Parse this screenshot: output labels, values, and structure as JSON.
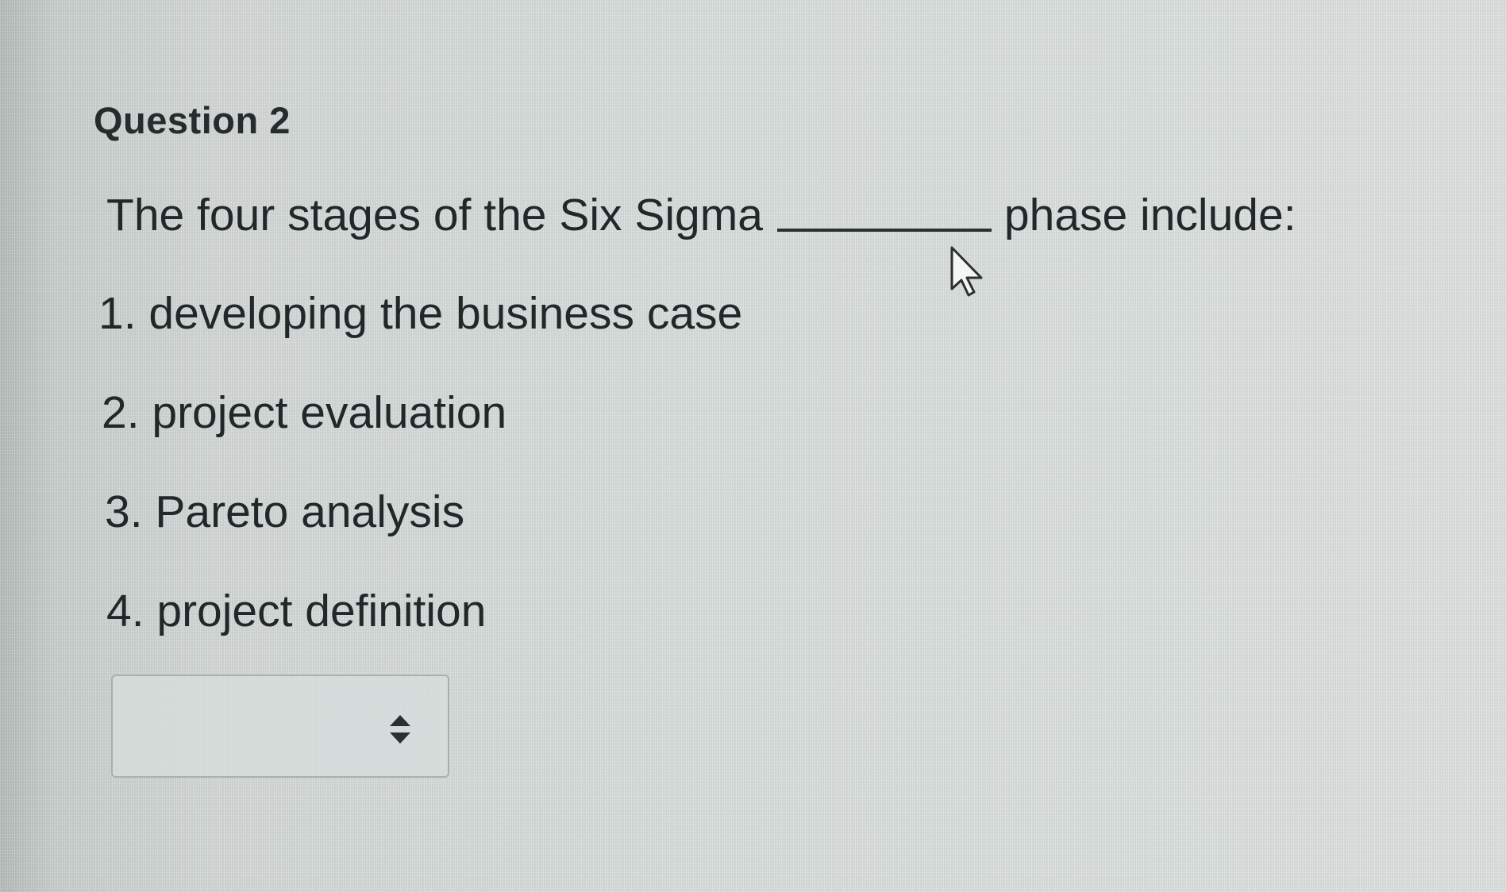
{
  "question": {
    "title": "Question 2",
    "prompt_before": "The four stages of the Six Sigma",
    "prompt_after": "phase include:",
    "stages": [
      "1. developing the business case",
      "2. project evaluation",
      "3. Pareto analysis",
      "4. project definition"
    ]
  },
  "answer_select": {
    "selected_value": "",
    "icon": "select-arrows-icon"
  },
  "cursor": {
    "icon": "mouse-pointer-icon"
  },
  "colors": {
    "text": "#22282a",
    "background": "#d9dfdd",
    "select_border": "#a9b0ae"
  }
}
